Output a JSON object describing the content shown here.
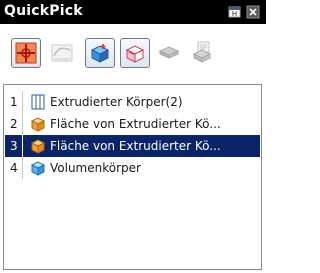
{
  "window": {
    "title": "QuickPick",
    "title_bar_color": "#000000",
    "maximize_icon": "maximize-icon",
    "close_icon": "close-icon"
  },
  "toolbar": {
    "items": [
      {
        "icon": "crosshair-filter-icon",
        "active": true
      },
      {
        "icon": "curve-filter-icon",
        "active": false
      },
      {
        "icon": "solid-body-filter-icon",
        "active": true
      },
      {
        "icon": "face-filter-icon",
        "active": true
      },
      {
        "icon": "sheet-body-filter-icon",
        "active": false
      },
      {
        "icon": "feature-filter-icon",
        "active": false
      }
    ]
  },
  "list": {
    "selected_index": 3,
    "selection_color": "#0a246a",
    "items": [
      {
        "num": "1",
        "icon": "extrude-feature-icon",
        "label": "Extrudierter Körper(2)"
      },
      {
        "num": "2",
        "icon": "face-cube-icon",
        "label": "Fläche von Extrudierter Kö..."
      },
      {
        "num": "3",
        "icon": "face-cube-icon",
        "label": "Fläche von Extrudierter Kö..."
      },
      {
        "num": "4",
        "icon": "solid-body-icon",
        "label": "Volumenkörper"
      }
    ]
  }
}
